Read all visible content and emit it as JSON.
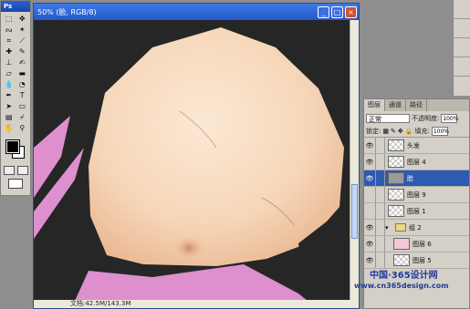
{
  "tools_palette": {
    "title": "Ps",
    "tools": [
      "marquee-tool",
      "move-tool",
      "lasso-tool",
      "magic-wand-tool",
      "crop-tool",
      "slice-tool",
      "healing-brush-tool",
      "brush-tool",
      "clone-stamp-tool",
      "history-brush-tool",
      "eraser-tool",
      "gradient-tool",
      "blur-tool",
      "dodge-tool",
      "pen-tool",
      "type-tool",
      "path-selection-tool",
      "shape-tool",
      "notes-tool",
      "eyedropper-tool",
      "hand-tool",
      "zoom-tool"
    ],
    "type_glyph": "T",
    "foreground_color": "#000000",
    "background_color": "#ffffff"
  },
  "document": {
    "title": "50% (脸, RGB/8)",
    "status_text": "文档:42.5M/143.3M"
  },
  "layers_palette": {
    "tabs": [
      "图层",
      "通道",
      "路径"
    ],
    "blend_mode": "正常",
    "opacity_label": "不透明度:",
    "opacity_value": "100%",
    "lock_label": "锁定:",
    "fill_label": "填充:",
    "fill_value": "100%",
    "layers": [
      {
        "name": "头发",
        "visible": true,
        "selected": false,
        "kind": "layer"
      },
      {
        "name": "图层 4",
        "visible": true,
        "selected": false,
        "kind": "layer"
      },
      {
        "name": "脸",
        "visible": true,
        "selected": true,
        "kind": "layer"
      },
      {
        "name": "图层 9",
        "visible": false,
        "selected": false,
        "kind": "layer"
      },
      {
        "name": "图层 1",
        "visible": false,
        "selected": false,
        "kind": "layer"
      },
      {
        "name": "组 2",
        "visible": true,
        "selected": false,
        "kind": "group"
      },
      {
        "name": "图层 6",
        "visible": true,
        "selected": false,
        "kind": "layer"
      },
      {
        "name": "图层 5",
        "visible": true,
        "selected": false,
        "kind": "layer"
      }
    ]
  },
  "watermark": {
    "line1": "中国·365设计网",
    "line2": "www.cn365design.com"
  },
  "colors": {
    "skin": "#f6d9bf",
    "pink": "#e08fd0",
    "hair": "#262626",
    "selection": "#2e5ab0"
  }
}
